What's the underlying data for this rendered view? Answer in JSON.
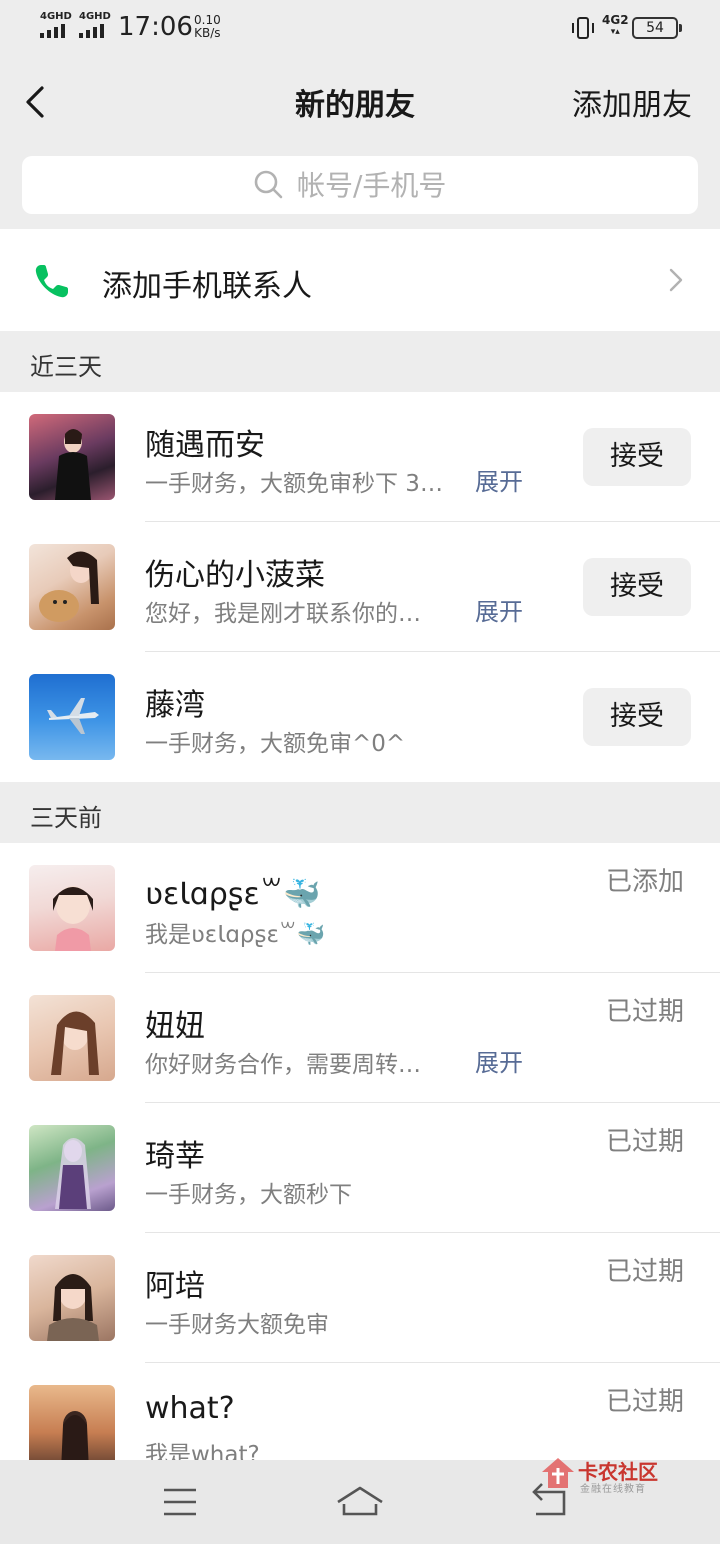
{
  "status_bar": {
    "signal1": "4GHD",
    "signal2": "4GHD",
    "time": "17:06",
    "speed_value": "0.10",
    "speed_unit": "KB/s",
    "network": "4G2",
    "battery": "54"
  },
  "nav": {
    "title": "新的朋友",
    "action": "添加朋友"
  },
  "search": {
    "placeholder": "帐号/手机号"
  },
  "phone_contacts": {
    "label": "添加手机联系人"
  },
  "sections": [
    {
      "header": "近三天",
      "items": [
        {
          "name": "随遇而安",
          "message": "一手财务，大额免审秒下 3…",
          "expand": "展开",
          "action": "接受"
        },
        {
          "name": "伤心的小菠菜",
          "message": "您好，我是刚才联系你的…",
          "expand": "展开",
          "action": "接受"
        },
        {
          "name": "藤湾",
          "message": "一手财务，大额免审^0^",
          "action": "接受"
        }
      ]
    },
    {
      "header": "三天前",
      "items": [
        {
          "name": "ʋɛƖɑρʂɛ꒳🐳",
          "message": "我是ʋɛƖɑρʂɛ꒳🐳",
          "status": "已添加"
        },
        {
          "name": "妞妞",
          "message": "你好财务合作，需要周转…",
          "expand": "展开",
          "status": "已过期"
        },
        {
          "name": "琦莘",
          "message": "一手财务，大额秒下",
          "status": "已过期"
        },
        {
          "name": "阿培",
          "message": "一手财务大额免审",
          "status": "已过期"
        },
        {
          "name": "what?",
          "message": "我是what?",
          "status": "已过期"
        }
      ]
    }
  ],
  "watermark": {
    "title": "卡农社区",
    "subtitle": "金融在线教育"
  },
  "colors": {
    "background": "#ededed",
    "link": "#576b95",
    "phone_icon": "#07c160"
  }
}
